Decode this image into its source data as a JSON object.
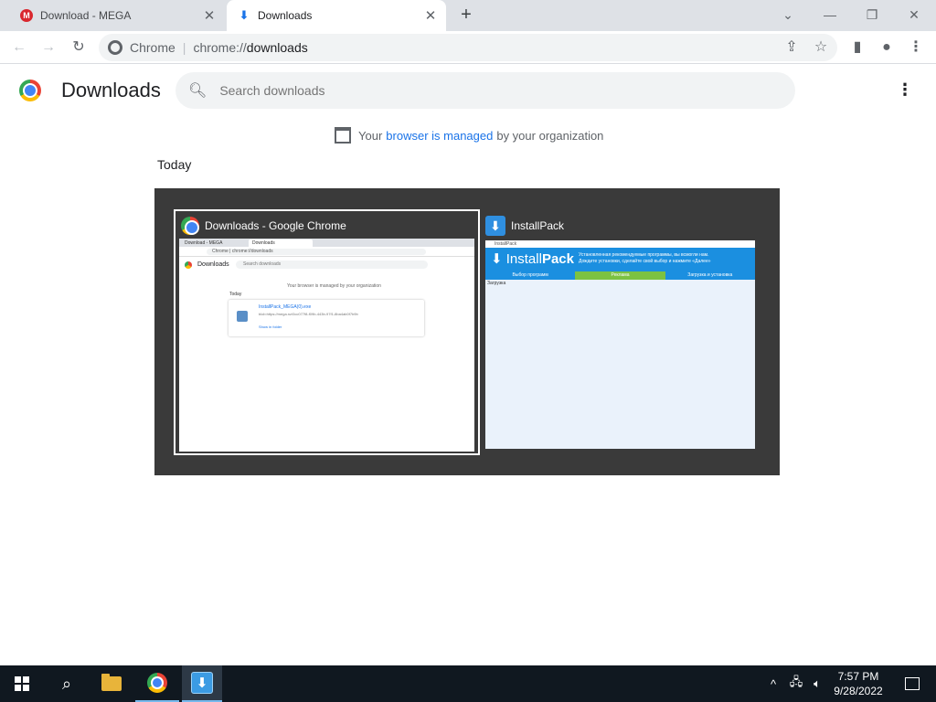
{
  "tabs": [
    {
      "title": "Download - MEGA",
      "icon": "mega-icon",
      "active": false
    },
    {
      "title": "Downloads",
      "icon": "download-icon",
      "active": true
    }
  ],
  "toolbar": {
    "chip": "Chrome",
    "url_scheme": "chrome://",
    "url_path": "downloads"
  },
  "page": {
    "title": "Downloads",
    "search_placeholder": "Search downloads",
    "managed_prefix": "Your",
    "managed_link": "browser is managed",
    "managed_suffix": "by your organization",
    "today_label": "Today"
  },
  "switcher": {
    "windows": [
      {
        "title": "Downloads - Google Chrome",
        "selected": true,
        "thumb": {
          "tab1": "Download - MEGA",
          "tab2": "Downloads",
          "url": "Chrome | chrome://downloads",
          "page_title": "Downloads",
          "search": "Search downloads",
          "managed": "Your browser is managed by your organization",
          "today": "Today",
          "file_name": "InstallPack_MEGA(0).exe",
          "file_url": "blob:https://mega.nz/0cc077f8-f09b-443b-97f1-8ba4ab0f7b9b",
          "show_in_folder": "Show in folder"
        }
      },
      {
        "title": "InstallPack",
        "selected": false,
        "thumb": {
          "window_title": "InstallPack",
          "logo_install": "Install",
          "logo_pack": "Pack",
          "message_line1": "Установленная рекомендуемые программы, вы всмогли нам.",
          "message_line2": "Дождите установки, сделайте свой выбор и нажмите «Далее»",
          "steps": [
            "Выбор программ",
            "Реклама",
            "Загрузка и установка"
          ],
          "loading": "Загрузка"
        }
      }
    ]
  },
  "taskbar": {
    "time": "7:57 PM",
    "date": "9/28/2022"
  },
  "colors": {
    "tabstrip": "#dee1e6",
    "link": "#1a73e8",
    "switcher_bg": "#3a3a3a",
    "taskbar": "#101820",
    "installpack_blue": "#1b8fe0",
    "installpack_green": "#7cc242"
  }
}
